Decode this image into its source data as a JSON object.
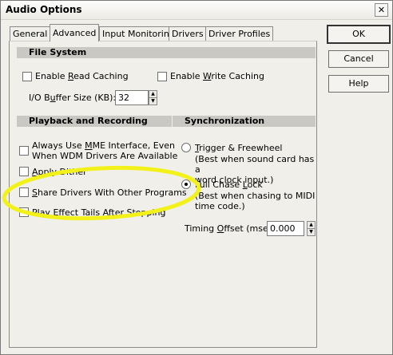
{
  "window": {
    "title": "Audio Options",
    "close_glyph": "✕"
  },
  "tabs": [
    "General",
    "Advanced",
    "Input Monitoring",
    "Drivers",
    "Driver Profiles"
  ],
  "active_tab": "Advanced",
  "buttons": {
    "ok": "OK",
    "cancel": "Cancel",
    "help": "Help"
  },
  "file_system": {
    "heading": "File System",
    "read_pre": "Enable ",
    "read_ul": "R",
    "read_post": "ead Caching",
    "write_pre": "Enable ",
    "write_ul": "W",
    "write_post": "rite Caching",
    "buffer_pre": "I/O B",
    "buffer_ul": "u",
    "buffer_post": "ffer Size (KB):",
    "buffer_value": "32"
  },
  "playback": {
    "heading": "Playback and Recording",
    "mme_pre": "Always Use ",
    "mme_ul": "M",
    "mme_post": "ME Interface, Even\nWhen WDM Drivers Are Available",
    "dither_ul": "A",
    "dither_post": "pply Dither",
    "share_pre": "",
    "share_ul": "S",
    "share_post": "hare Drivers With Other Programs",
    "tails_pre": "Play ",
    "tails_ul": "E",
    "tails_post": "ffect Tails After Stopping"
  },
  "sync": {
    "heading": "Synchronization",
    "trigger_ul": "T",
    "trigger_post": "rigger & Freewheel",
    "trigger_desc": "(Best when sound card has a\nword clock input.)",
    "full_pre": "Full Chase ",
    "full_ul": "L",
    "full_post": "ock",
    "full_desc": "(Best when chasing to MIDI\ntime code.)",
    "timing_pre": "Timing ",
    "timing_ul": "O",
    "timing_post": "ffset (msec):",
    "timing_value": "0.000"
  },
  "states": {
    "enable_read_caching": false,
    "enable_write_caching": false,
    "always_use_mme": false,
    "apply_dither": false,
    "share_drivers": false,
    "play_effect_tails": false,
    "sync_mode": "full_chase_lock"
  },
  "colors": {
    "highlight_annotation": "#f2f21a",
    "section_header": "#c9c8c2"
  },
  "icons": {
    "spin_up": "▲",
    "spin_down": "▼"
  }
}
